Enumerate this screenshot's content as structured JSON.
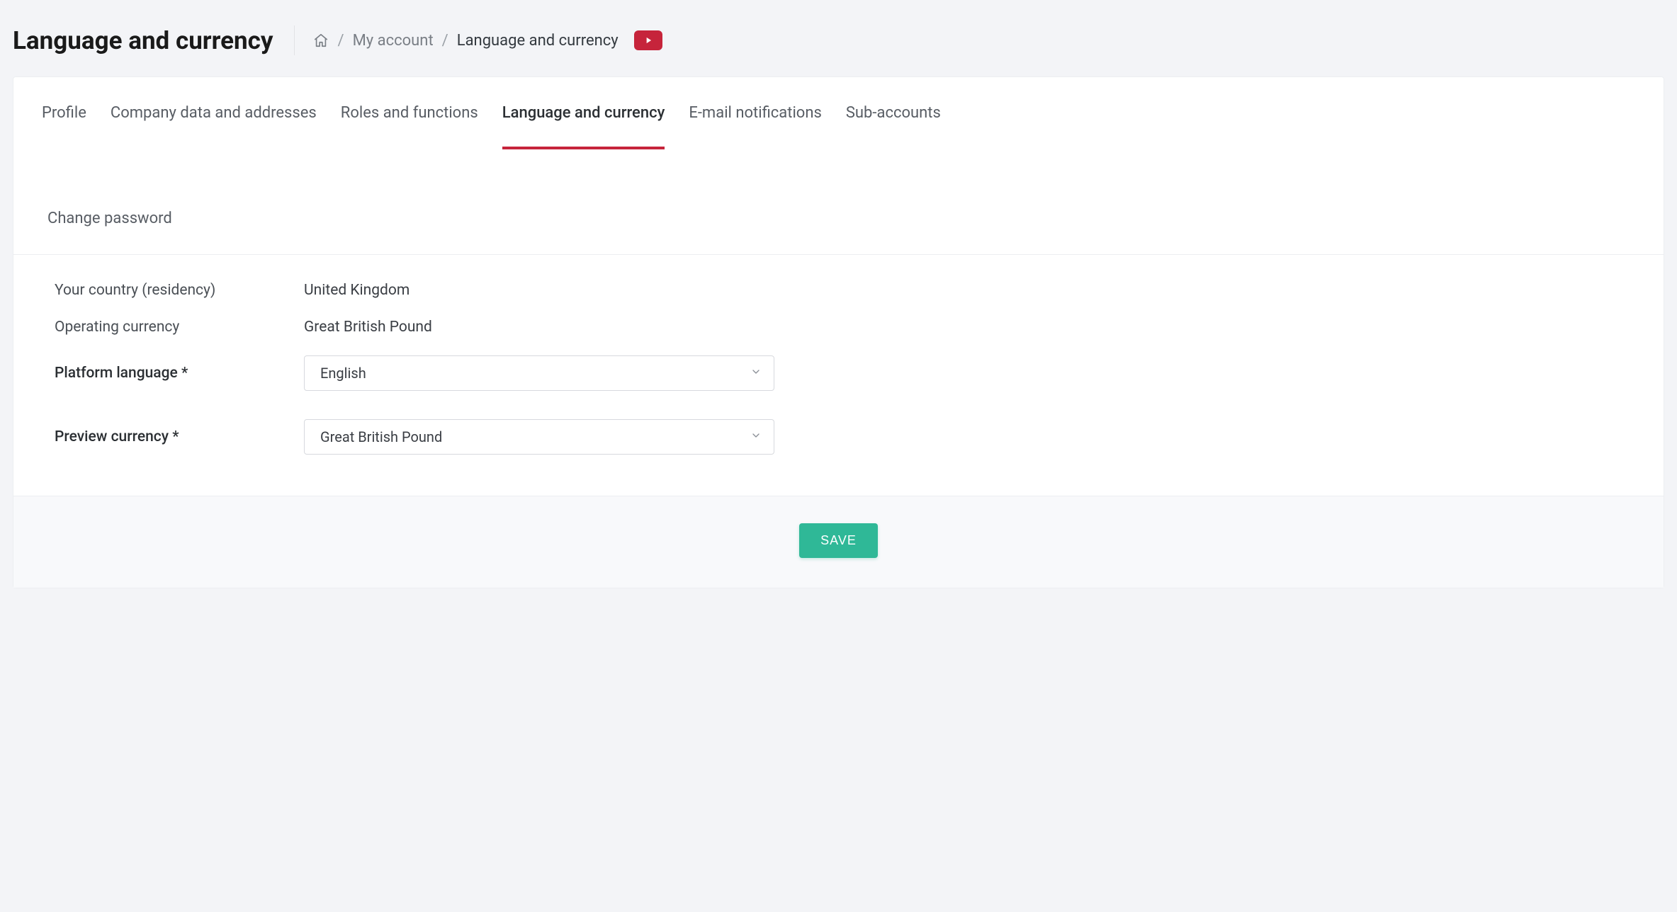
{
  "header": {
    "title": "Language and currency",
    "breadcrumb": {
      "my_account": "My account",
      "current": "Language and currency"
    }
  },
  "tabs": {
    "profile": "Profile",
    "company_data": "Company data and addresses",
    "roles": "Roles and functions",
    "language_currency": "Language and currency",
    "email_notifications": "E-mail notifications",
    "sub_accounts": "Sub-accounts",
    "change_password": "Change password",
    "active": "language_currency"
  },
  "form": {
    "country_label": "Your country (residency)",
    "country_value": "United Kingdom",
    "operating_currency_label": "Operating currency",
    "operating_currency_value": "Great British Pound",
    "platform_language_label": "Platform language *",
    "platform_language_value": "English",
    "preview_currency_label": "Preview currency *",
    "preview_currency_value": "Great British Pound"
  },
  "actions": {
    "save": "SAVE"
  },
  "colors": {
    "accent": "#c6243b",
    "primary_action": "#2fb897",
    "page_bg": "#f3f4f7",
    "card_bg": "#ffffff"
  }
}
